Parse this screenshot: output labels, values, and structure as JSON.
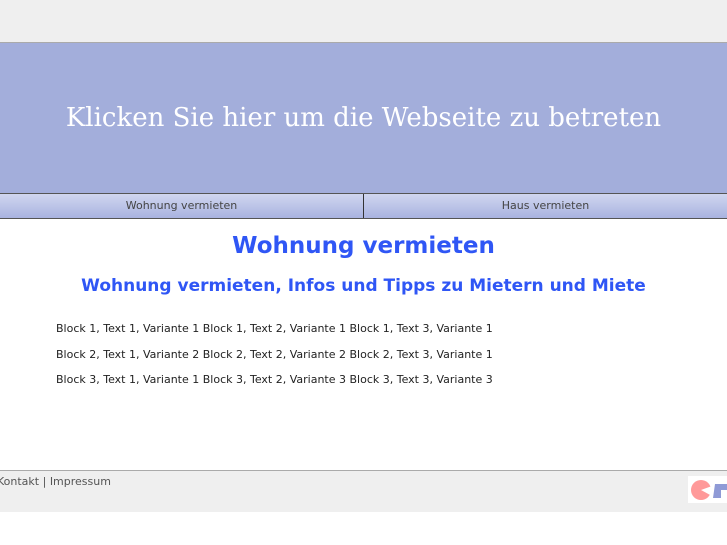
{
  "banner": {
    "text": "Klicken Sie hier um die Webseite zu betreten"
  },
  "nav": [
    "Wohnung vermieten",
    "Haus vermieten"
  ],
  "title": "Wohnung vermieten",
  "subtitle": "Wohnung vermieten, Infos und Tipps zu Mietern und Miete",
  "lines": [
    "Block 1, Text 1, Variante 1 Block 1, Text 2, Variante 1 Block 1, Text 3, Variante 1",
    "Block 2, Text 1, Variante 2 Block 2, Text 2, Variante 2 Block 2, Text 3, Variante 1",
    "Block 3, Text 1, Variante 1 Block 3, Text 2, Variante 3 Block 3, Text 3, Variante 3"
  ],
  "footer": {
    "kontakt": "Kontakt",
    "sep": " | ",
    "impressum": "Impressum"
  }
}
